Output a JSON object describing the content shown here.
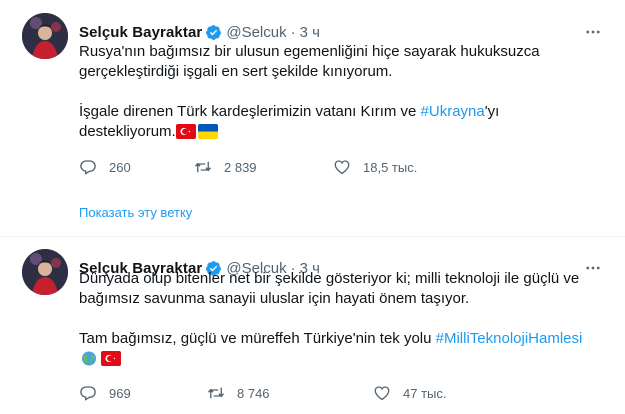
{
  "tweets": [
    {
      "display_name": "Selçuk Bayraktar",
      "handle": "@Selcuk",
      "separator": "·",
      "time": "3 ч",
      "lines_block1": [
        "Rusya'nın bağımsız bir ulusun egemenliğini hiçe sayarak hukuksuzca",
        "gerçekleştirdiği işgali en sert şekilde kınıyorum."
      ],
      "line3_before": "İşgale direnen Türk kardeşlerimizin vatanı Kırım ve ",
      "line3_hashtag": "#Ukrayna",
      "line3_after": "'yı",
      "line4": "destekliyorum.",
      "flags": [
        "turkey-flag",
        "ukraine-flag"
      ],
      "replies": "260",
      "retweets": "2 839",
      "likes": "18,5 тыс.",
      "show_thread": "Показать эту ветку"
    },
    {
      "display_name": "Selçuk Bayraktar",
      "handle": "@Selcuk",
      "separator": "·",
      "time": "3 ч",
      "lines_block1": [
        "Dünyada olup bitenler net bir şekilde gösteriyor ki; milli teknoloji ile güçlü ve",
        "bağımsız savunma sanayii uluslar için hayati önem taşıyor."
      ],
      "line3_before": "Tam bağımsız, güçlü ve müreffeh Türkiye'nin tek yolu ",
      "line3_hashtag": "#MilliTeknolojiHamlesi",
      "flags": [
        "earth-globe-icon",
        "turkey-flag"
      ],
      "replies": "969",
      "retweets": "8 746",
      "likes": "47 тыс."
    }
  ],
  "colors": {
    "link": "#1d9bf0",
    "text": "#0f1419",
    "secondary": "#536471",
    "divider": "#eff3f4"
  }
}
